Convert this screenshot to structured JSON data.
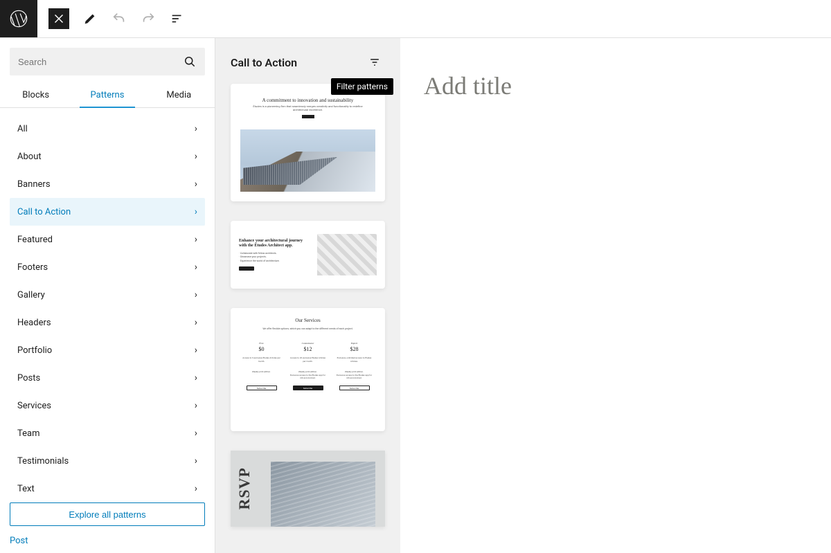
{
  "topbar": {
    "undo_disabled": true,
    "redo_disabled": true
  },
  "search": {
    "placeholder": "Search"
  },
  "tabs": {
    "blocks": "Blocks",
    "patterns": "Patterns",
    "media": "Media",
    "active": "Patterns"
  },
  "categories": [
    {
      "label": "All",
      "active": false
    },
    {
      "label": "About",
      "active": false
    },
    {
      "label": "Banners",
      "active": false
    },
    {
      "label": "Call to Action",
      "active": true
    },
    {
      "label": "Featured",
      "active": false
    },
    {
      "label": "Footers",
      "active": false
    },
    {
      "label": "Gallery",
      "active": false
    },
    {
      "label": "Headers",
      "active": false
    },
    {
      "label": "Portfolio",
      "active": false
    },
    {
      "label": "Posts",
      "active": false
    },
    {
      "label": "Services",
      "active": false
    },
    {
      "label": "Team",
      "active": false
    },
    {
      "label": "Testimonials",
      "active": false
    },
    {
      "label": "Text",
      "active": false
    }
  ],
  "explore_label": "Explore all patterns",
  "footer_link": "Post",
  "previews": {
    "heading": "Call to Action",
    "tooltip": "Filter patterns",
    "card1": {
      "title": "A commitment to innovation and sustainability",
      "sub": "Études is a pioneering firm that seamlessly merges creativity and functionality to redefine architectural excellence."
    },
    "card2": {
      "title": "Enhance your architectural journey with the Études Architect app.",
      "bul1": "· Collaborate with fellow architects.",
      "bul2": "· Showcase your projects.",
      "bul3": "· Experience the world of architecture."
    },
    "card3": {
      "title": "Our Services",
      "sub": "We offer flexible options, which you can adapt to the different needs of each project.",
      "plans": [
        {
          "name": "Free",
          "price": "$0",
          "d1": "Access to 5 exclusive Études Articles per month.",
          "d2": "Weekly print edition.",
          "btn": "Subscribe"
        },
        {
          "name": "Connoisseur",
          "price": "$12",
          "d1": "Access to 20 exclusive Études Articles per month.",
          "d2": "Weekly print edition.|Exclusive access to the Études app for iOS and Android.",
          "btn": "Subscribe"
        },
        {
          "name": "Expert",
          "price": "$28",
          "d1": "Exclusive, unlimited access to Études Articles.",
          "d2": "Weekly print edition.|Exclusive access to the Études app for iOS and Android.",
          "btn": "Subscribe"
        }
      ]
    },
    "card4": {
      "label": "RSVP"
    }
  },
  "canvas": {
    "title_placeholder": "Add title"
  }
}
